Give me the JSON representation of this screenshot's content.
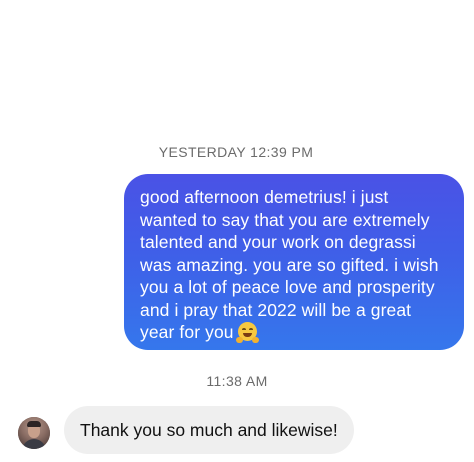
{
  "thread": {
    "messages": [
      {
        "id": "m1",
        "timestamp": "YESTERDAY 12:39 PM",
        "direction": "outgoing",
        "text_lines": [
          "good afternoon demetrius! i just",
          "wanted to say that you are extremely",
          "talented and your work on degrassi",
          "was amazing. you are so gifted. i wish",
          "you a lot of peace love and prosperity",
          "and i pray that 2022 will be a great",
          "year for you"
        ],
        "emoji": "hugging-face-icon"
      },
      {
        "id": "m2",
        "timestamp": "11:38 AM",
        "direction": "incoming",
        "text": "Thank you so much and likewise!"
      }
    ]
  },
  "colors": {
    "outgoing_bubble_top": "#4a52e6",
    "outgoing_bubble_bottom": "#3577ec",
    "incoming_bubble": "#efefef",
    "timestamp_text": "#6b6b6b"
  }
}
